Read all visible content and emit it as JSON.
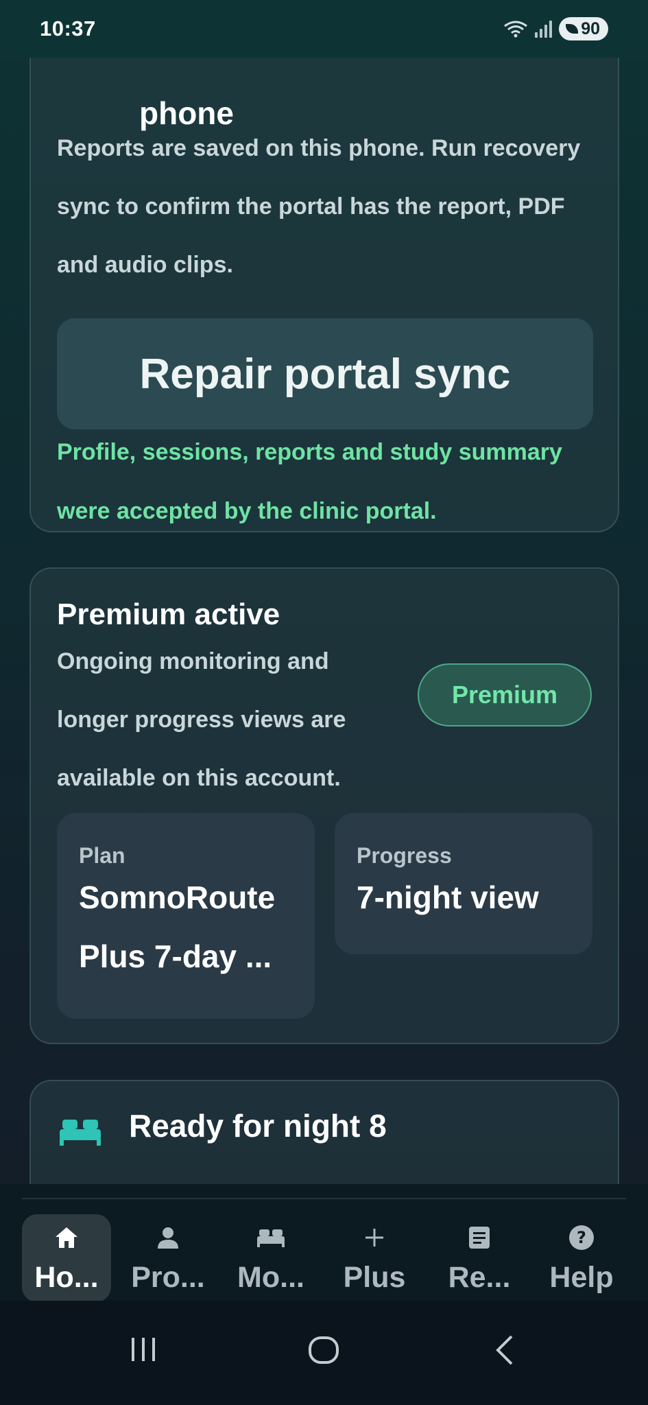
{
  "status_bar": {
    "time": "10:37",
    "battery": "90"
  },
  "sync_card": {
    "heading": "phone",
    "body": "Reports are saved on this phone. Run recovery sync to confirm the portal has the report, PDF and audio clips.",
    "button_label": "Repair portal sync",
    "status_text": "Profile, sessions, reports and study summary were accepted by the clinic portal."
  },
  "premium_card": {
    "title": "Premium active",
    "body": "Ongoing monitoring and longer progress views are available on this account.",
    "badge": "Premium",
    "plan_label": "Plan",
    "plan_value": "SomnoRoute Plus 7-day ...",
    "progress_label": "Progress",
    "progress_value": "7-night view"
  },
  "night_card": {
    "title": "Ready for night 8"
  },
  "bottom_nav": {
    "items": [
      {
        "label": "Ho...",
        "icon": "home-icon"
      },
      {
        "label": "Pro...",
        "icon": "person-icon"
      },
      {
        "label": "Mo...",
        "icon": "bed-icon"
      },
      {
        "label": "Plus",
        "icon": "plus-icon"
      },
      {
        "label": "Re...",
        "icon": "report-icon"
      },
      {
        "label": "Help",
        "icon": "help-icon"
      }
    ]
  },
  "colors": {
    "accent_green": "#6fe3a4",
    "bed_icon": "#2ec4b6",
    "badge_bg": "#2a5a4f"
  }
}
